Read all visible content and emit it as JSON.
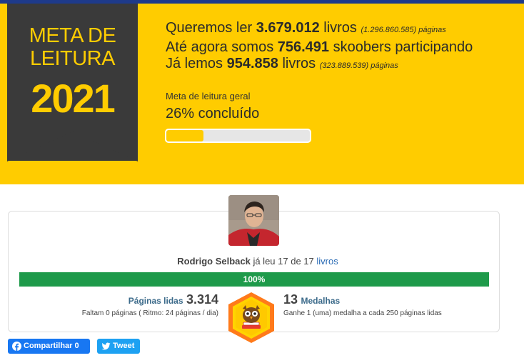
{
  "banner": {
    "title": "META DE LEITURA",
    "year": "2021",
    "line1": {
      "prefix": "Queremos ler ",
      "number": "3.679.012",
      "suffix": " livros",
      "note": "(1.296.860.585) páginas"
    },
    "line2": {
      "prefix": "Até agora somos ",
      "number": "756.491",
      "suffix": " skoobers participando"
    },
    "line3": {
      "prefix": "Já lemos ",
      "number": "954.858",
      "suffix": " livros",
      "note": "(323.889.539) páginas"
    },
    "goal_label": "Meta de leitura geral",
    "goal_percent_text": "26% concluído",
    "goal_progress": 0.26,
    "colors": {
      "yellow": "#ffcc00",
      "dark": "#3a3a3a"
    }
  },
  "user": {
    "name": "Rodrigo Selback",
    "read_text": " já leu 17 de 17 ",
    "books_link": "livros",
    "progress": 1.0,
    "progress_text": "100%",
    "pages_label": "Páginas lidas",
    "pages_value": "3.314",
    "pages_sub": "Faltam 0 páginas ( Ritmo: 24 páginas / dia)",
    "medals_value": "13",
    "medals_label": "Medalhas",
    "medals_sub": "Ganhe 1 (uma) medalha a cada 250 páginas lidas",
    "colors": {
      "progress": "#1e9a4a",
      "link": "#2a6bb5"
    }
  },
  "share": {
    "facebook_label": "Compartilhar 0",
    "twitter_label": "Tweet",
    "facebook_icon": "facebook-icon",
    "twitter_icon": "twitter-bird-icon"
  }
}
